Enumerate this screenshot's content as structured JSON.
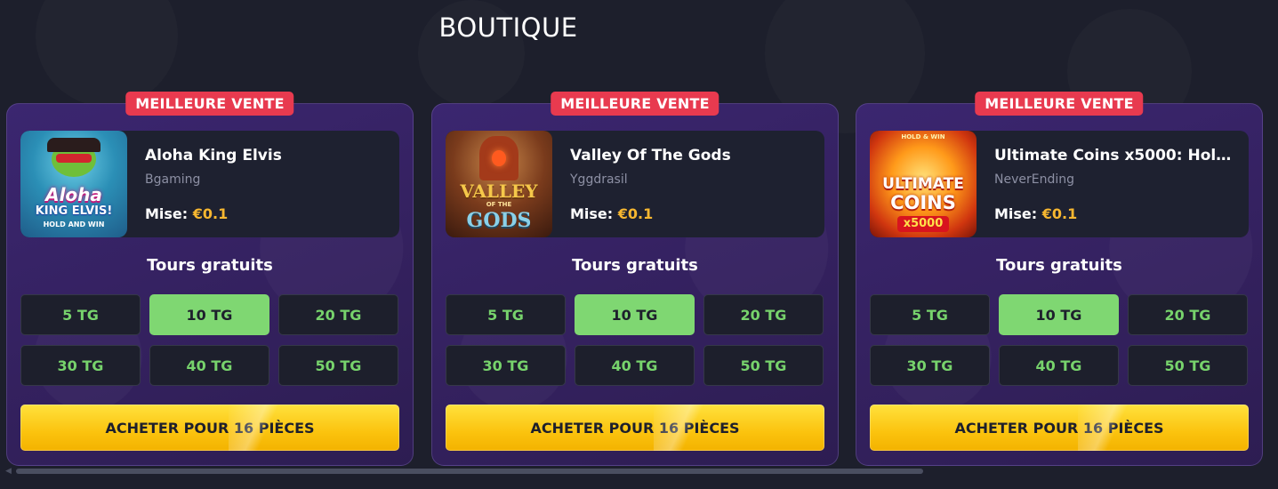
{
  "page": {
    "title": "BOUTIQUE"
  },
  "cards": [
    {
      "badge": "MEILLEURE VENTE",
      "game_name": "Aloha King Elvis",
      "provider": "Bgaming",
      "bet_label": "Mise:",
      "bet_value": "€0.1",
      "thumb_lines": [
        "Aloha",
        "KING ELVIS!",
        "HOLD AND WIN"
      ],
      "spins_title": "Tours gratuits",
      "options": [
        "5 TG",
        "10 TG",
        "20 TG",
        "30 TG",
        "40 TG",
        "50 TG"
      ],
      "selected_option": "10 TG",
      "buy_label": "ACHETER POUR 16 PIÈCES"
    },
    {
      "badge": "MEILLEURE VENTE",
      "game_name": "Valley Of The Gods",
      "provider": "Yggdrasil",
      "bet_label": "Mise:",
      "bet_value": "€0.1",
      "thumb_lines": [
        "VALLEY",
        "OF THE",
        "GODS"
      ],
      "spins_title": "Tours gratuits",
      "options": [
        "5 TG",
        "10 TG",
        "20 TG",
        "30 TG",
        "40 TG",
        "50 TG"
      ],
      "selected_option": "10 TG",
      "buy_label": "ACHETER POUR 16 PIÈCES"
    },
    {
      "badge": "MEILLEURE VENTE",
      "game_name": "Ultimate Coins x5000: Hold…",
      "provider": "NeverEnding",
      "bet_label": "Mise:",
      "bet_value": "€0.1",
      "thumb_lines": [
        "HOLD & WIN",
        "ULTIMATE",
        "COINS",
        "x5000"
      ],
      "spins_title": "Tours gratuits",
      "options": [
        "5 TG",
        "10 TG",
        "20 TG",
        "30 TG",
        "40 TG",
        "50 TG"
      ],
      "selected_option": "10 TG",
      "buy_label": "ACHETER POUR 16 PIÈCES"
    }
  ],
  "colors": {
    "background": "#1d1f2c",
    "card": "#3b2670",
    "badge": "#e83a4f",
    "bet_value": "#f7b730",
    "option_text": "#77d36c",
    "option_selected": "#7fd772",
    "buy_button": "#fbc30e"
  }
}
